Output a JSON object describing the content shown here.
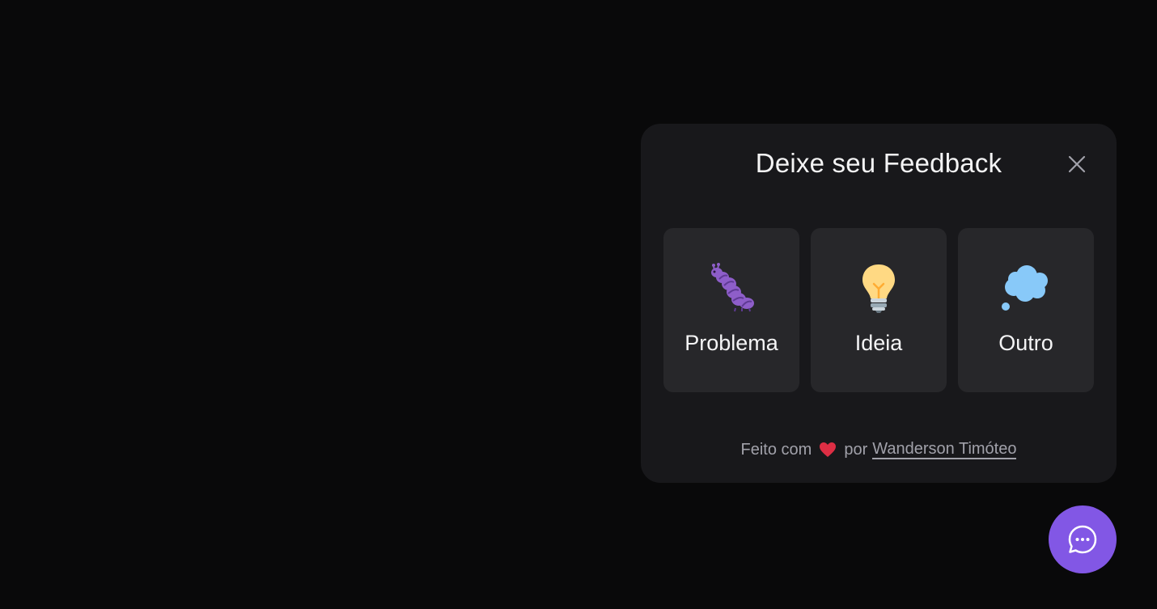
{
  "feedback_widget": {
    "title": "Deixe seu Feedback",
    "close_icon": "close-icon",
    "options": [
      {
        "label": "Problema",
        "icon": "bug-icon"
      },
      {
        "label": "Ideia",
        "icon": "lightbulb-icon"
      },
      {
        "label": "Outro",
        "icon": "thought-balloon-icon"
      }
    ],
    "footer": {
      "prefix": "Feito com",
      "heart_icon": "heart-icon",
      "middle": "por",
      "author": "Wanderson Timóteo"
    }
  },
  "fab": {
    "icon": "chat-bubble-icon"
  },
  "colors": {
    "background": "#09090a",
    "panel": "#18181b",
    "card": "#27272a",
    "brand": "#8257e5",
    "text": "#f4f4f5",
    "muted_text": "#a1a1aa"
  }
}
